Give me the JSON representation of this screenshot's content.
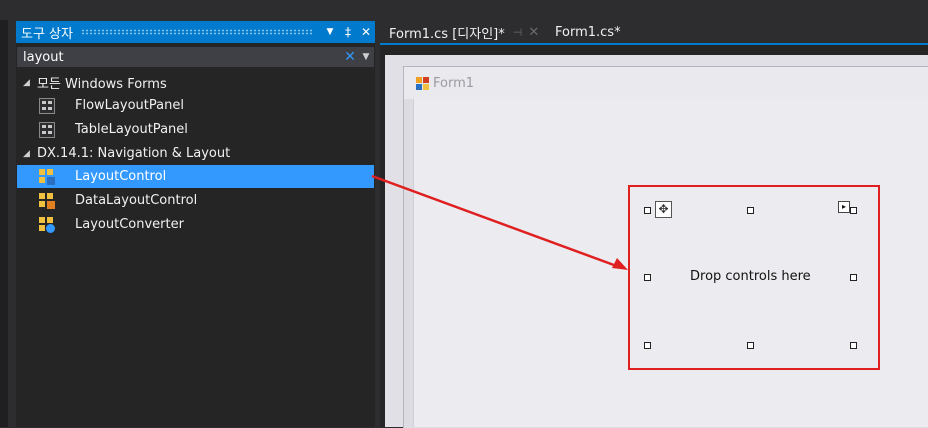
{
  "toolbox": {
    "title": "도구 상자",
    "header_buttons": {
      "dropdown": "▼",
      "pin": "‡",
      "close": "✕"
    },
    "search": {
      "value": "layout",
      "clear": "✕",
      "dropdown": "▼"
    },
    "groups": [
      {
        "label": "모든 Windows Forms",
        "items": [
          {
            "label": "FlowLayoutPanel",
            "icon": "flow-layout-panel-icon"
          },
          {
            "label": "TableLayoutPanel",
            "icon": "table-layout-panel-icon"
          }
        ]
      },
      {
        "label": "DX.14.1: Navigation & Layout",
        "items": [
          {
            "label": "LayoutControl",
            "icon": "layout-control-icon",
            "selected": true
          },
          {
            "label": "DataLayoutControl",
            "icon": "data-layout-control-icon"
          },
          {
            "label": "LayoutConverter",
            "icon": "layout-converter-icon"
          }
        ]
      }
    ]
  },
  "tabs": {
    "design": {
      "label": "Form1.cs [디자인]*",
      "pin": "⊣",
      "close": "✕"
    },
    "code": {
      "label": "Form1.cs*"
    }
  },
  "form": {
    "title": "Form1"
  },
  "layout_control": {
    "placeholder": "Drop controls here",
    "move_glyph": "✥",
    "tasks_glyph": "▸"
  },
  "colors": {
    "accent": "#007acc",
    "selection": "#3399ff",
    "highlight": "#e02020",
    "panel": "#252526"
  }
}
